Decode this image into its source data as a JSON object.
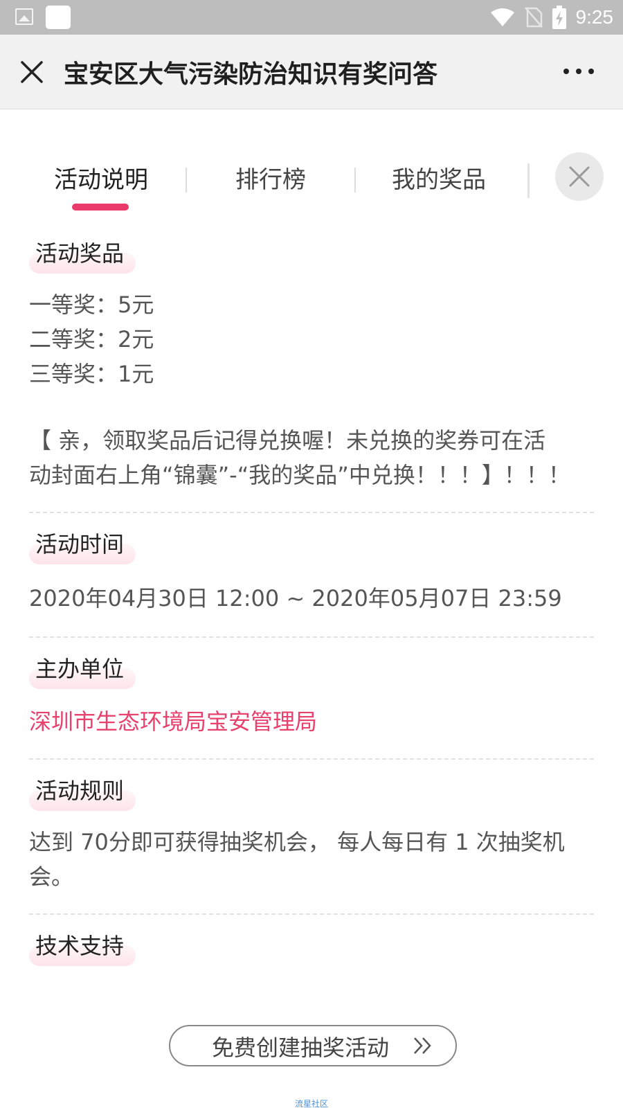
{
  "status_bar": {
    "time": "9:25",
    "icons": [
      "photo-icon",
      "app-icon",
      "wifi-icon",
      "no-sim-icon",
      "battery-charging-icon"
    ]
  },
  "titlebar": {
    "title": "宝安区大气污染防治知识有奖问答",
    "close_icon": "close-icon",
    "more_icon": "more-icon"
  },
  "tabs": [
    {
      "label": "活动说明",
      "active": true
    },
    {
      "label": "排行榜",
      "active": false
    },
    {
      "label": "我的奖品",
      "active": false
    }
  ],
  "sections": {
    "prizes": {
      "heading": "活动奖品",
      "items": [
        "一等奖：5元",
        "二等奖：2元",
        "三等奖：1元"
      ],
      "notice_line1": "【 亲，领取奖品后记得兑换喔！未兑换的奖券可在活",
      "notice_line2": "动封面右上角“锦囊”-“我的奖品”中兑换！！！】！！！"
    },
    "time": {
      "heading": "活动时间",
      "text": "2020年04月30日 12:00 ~ 2020年05月07日 23:59"
    },
    "organizer": {
      "heading": "主办单位",
      "text": "深圳市生态环境局宝安管理局"
    },
    "rules": {
      "heading": "活动规则",
      "line1": "达到 70分即可获得抽奖机会， 每人每日有 1 次抽奖机",
      "line2": "会。"
    },
    "support": {
      "heading": "技术支持"
    }
  },
  "create_button": {
    "label": "免费创建抽奖活动"
  },
  "footer": {
    "brand": "流星社区"
  },
  "colors": {
    "accent": "#ea3a6a",
    "organizer_text": "#e8416d",
    "status_bar": "#bdbdbd",
    "titlebar": "#f1f1f1"
  }
}
